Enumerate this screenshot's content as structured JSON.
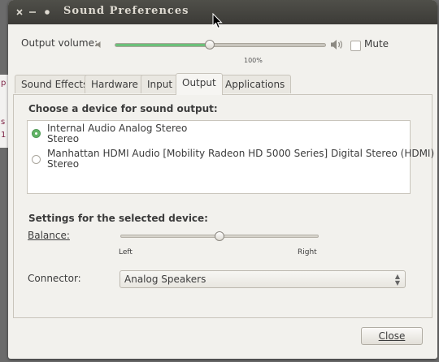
{
  "window": {
    "title": "Sound Preferences",
    "buttons": [
      "close-icon",
      "minimize-icon",
      "maximize-icon"
    ]
  },
  "volume": {
    "label": "Output volume:",
    "percent_text": "100%",
    "level": 0.45,
    "mute_label": "Mute",
    "mute_checked": false
  },
  "tabs": [
    {
      "label": "Sound Effects",
      "active": false
    },
    {
      "label": "Hardware",
      "active": false
    },
    {
      "label": "Input",
      "active": false
    },
    {
      "label": "Output",
      "active": true
    },
    {
      "label": "Applications",
      "active": false
    }
  ],
  "output": {
    "choose_heading": "Choose a device for sound output:",
    "devices": [
      {
        "name": "Internal Audio Analog Stereo",
        "profile": "Stereo",
        "selected": true
      },
      {
        "name": "Manhattan HDMI Audio [Mobility Radeon HD 5000 Series] Digital Stereo (HDMI)",
        "profile": "Stereo",
        "selected": false
      }
    ],
    "settings_heading": "Settings for the selected device:",
    "balance_label": "Balance:",
    "balance_left": "Left",
    "balance_right": "Right",
    "balance_value": 0.5,
    "connector_label": "Connector:",
    "connector_value": "Analog Speakers"
  },
  "footer": {
    "close_label": "Close"
  },
  "background_fragments": [
    "p",
    "s",
    "1"
  ],
  "colors": {
    "titlebar": "#3c3b37",
    "volume_fill": "#6cc07a",
    "radio_selected": "#62b466"
  }
}
